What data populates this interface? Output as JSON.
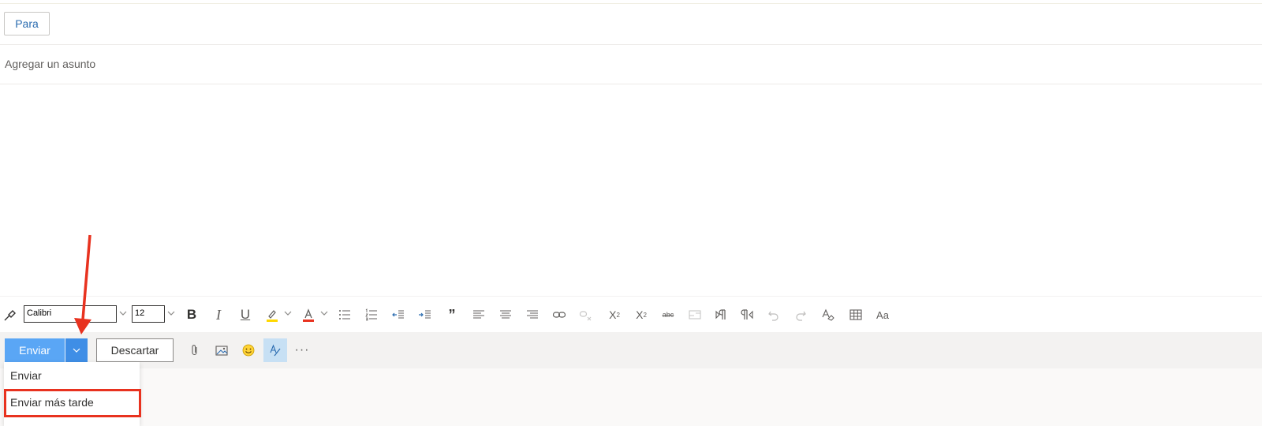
{
  "compose": {
    "to_label": "Para",
    "subject_placeholder": "Agregar un asunto"
  },
  "format_toolbar": {
    "font_name": "Calibri",
    "font_size": "12"
  },
  "actions": {
    "send_label": "Enviar",
    "discard_label": "Descartar"
  },
  "send_menu": {
    "items": [
      {
        "label": "Enviar"
      },
      {
        "label": "Enviar más tarde"
      }
    ]
  },
  "colors": {
    "send_primary": "#5aa6f5",
    "send_dropdown": "#3f8ee6",
    "annotation": "#e8321f",
    "to_link": "#2b6cb0"
  },
  "icons": {
    "format_painter": "paint-brush-icon",
    "bold": "bold-icon",
    "italic": "italic-icon",
    "underline": "underline-icon",
    "highlight": "highlighter-icon",
    "font_color": "font-color-icon",
    "bullets": "bullet-list-icon",
    "numbering": "numbered-list-icon",
    "outdent": "decrease-indent-icon",
    "indent": "increase-indent-icon",
    "quote": "quote-icon",
    "align_left": "align-left-icon",
    "align_center": "align-center-icon",
    "align_right": "align-right-icon",
    "link": "link-icon",
    "unlink": "unlink-icon",
    "superscript": "superscript-icon",
    "subscript": "subscript-icon",
    "strikethrough": "strikethrough-icon",
    "image_inline": "inline-image-icon",
    "ltr": "left-to-right-icon",
    "rtl": "right-to-left-icon",
    "undo": "undo-icon",
    "redo": "redo-icon",
    "clear_format": "clear-formatting-icon",
    "table": "table-icon",
    "styles": "font-styles-icon",
    "attach": "paperclip-icon",
    "picture": "picture-icon",
    "emoji": "emoji-icon",
    "editor": "editor-icon",
    "more": "more-options-icon"
  }
}
